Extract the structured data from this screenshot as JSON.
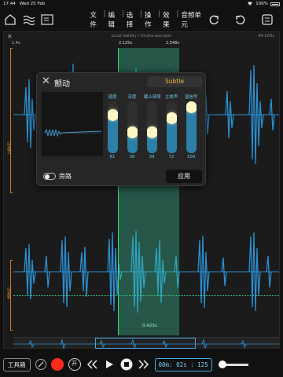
{
  "status_bar": {
    "time": "17:44",
    "date": "Wed 25 Feb",
    "battery": "100%"
  },
  "toolbar": {
    "menus": [
      "文件",
      "编辑",
      "选择",
      "操作",
      "效果",
      "音频单元"
    ],
    "separator": "|"
  },
  "editor": {
    "file_label": "Local Gallery / Drums.wav.wav",
    "sample_rate": "44.1KHz",
    "ticks": [
      "1.4s",
      "2.125s",
      "2.548s"
    ],
    "selection_length": "0.423s",
    "track_labels": [
      "正常的",
      "选择的"
    ]
  },
  "effect_panel": {
    "title": "颤动",
    "preset": "Subtle",
    "sliders": [
      {
        "label": "速度",
        "value": "81",
        "level": 0.8
      },
      {
        "label": "深度",
        "value": "38",
        "level": 0.37
      },
      {
        "label": "截止频率",
        "value": "39",
        "level": 0.38
      },
      {
        "label": "立体声",
        "value": "72",
        "level": 0.72
      },
      {
        "label": "湿信号",
        "value": "100",
        "level": 1.0
      }
    ],
    "bypass_label": "旁路",
    "apply_label": "应用"
  },
  "transport": {
    "tools_label": "工具箱",
    "open_label": "开",
    "time": "00m: 02s : 125"
  },
  "colors": {
    "wave": "#2b8fd0",
    "selection": "#3cc8a0",
    "playhead": "#36e06a",
    "record": "#ff2a1a",
    "preset_text": "#f0b63a"
  }
}
